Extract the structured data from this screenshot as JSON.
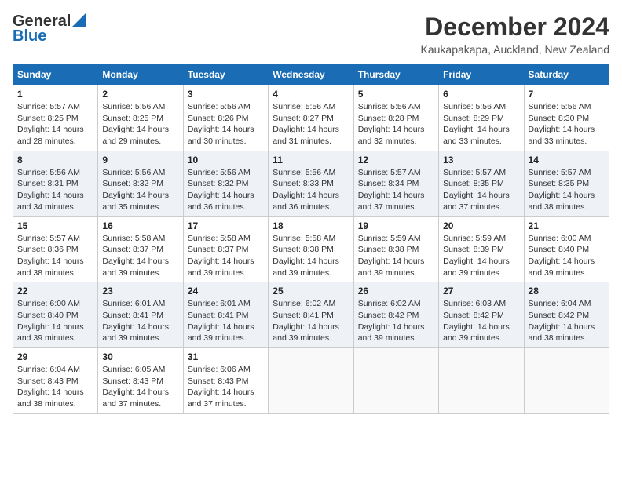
{
  "header": {
    "logo_general": "General",
    "logo_blue": "Blue",
    "month_title": "December 2024",
    "location": "Kaukapakapa, Auckland, New Zealand"
  },
  "calendar": {
    "days_of_week": [
      "Sunday",
      "Monday",
      "Tuesday",
      "Wednesday",
      "Thursday",
      "Friday",
      "Saturday"
    ],
    "weeks": [
      [
        {
          "day": "1",
          "sunrise": "5:57 AM",
          "sunset": "8:25 PM",
          "daylight": "14 hours and 28 minutes."
        },
        {
          "day": "2",
          "sunrise": "5:56 AM",
          "sunset": "8:25 PM",
          "daylight": "14 hours and 29 minutes."
        },
        {
          "day": "3",
          "sunrise": "5:56 AM",
          "sunset": "8:26 PM",
          "daylight": "14 hours and 30 minutes."
        },
        {
          "day": "4",
          "sunrise": "5:56 AM",
          "sunset": "8:27 PM",
          "daylight": "14 hours and 31 minutes."
        },
        {
          "day": "5",
          "sunrise": "5:56 AM",
          "sunset": "8:28 PM",
          "daylight": "14 hours and 32 minutes."
        },
        {
          "day": "6",
          "sunrise": "5:56 AM",
          "sunset": "8:29 PM",
          "daylight": "14 hours and 33 minutes."
        },
        {
          "day": "7",
          "sunrise": "5:56 AM",
          "sunset": "8:30 PM",
          "daylight": "14 hours and 33 minutes."
        }
      ],
      [
        {
          "day": "8",
          "sunrise": "5:56 AM",
          "sunset": "8:31 PM",
          "daylight": "14 hours and 34 minutes."
        },
        {
          "day": "9",
          "sunrise": "5:56 AM",
          "sunset": "8:32 PM",
          "daylight": "14 hours and 35 minutes."
        },
        {
          "day": "10",
          "sunrise": "5:56 AM",
          "sunset": "8:32 PM",
          "daylight": "14 hours and 36 minutes."
        },
        {
          "day": "11",
          "sunrise": "5:56 AM",
          "sunset": "8:33 PM",
          "daylight": "14 hours and 36 minutes."
        },
        {
          "day": "12",
          "sunrise": "5:57 AM",
          "sunset": "8:34 PM",
          "daylight": "14 hours and 37 minutes."
        },
        {
          "day": "13",
          "sunrise": "5:57 AM",
          "sunset": "8:35 PM",
          "daylight": "14 hours and 37 minutes."
        },
        {
          "day": "14",
          "sunrise": "5:57 AM",
          "sunset": "8:35 PM",
          "daylight": "14 hours and 38 minutes."
        }
      ],
      [
        {
          "day": "15",
          "sunrise": "5:57 AM",
          "sunset": "8:36 PM",
          "daylight": "14 hours and 38 minutes."
        },
        {
          "day": "16",
          "sunrise": "5:58 AM",
          "sunset": "8:37 PM",
          "daylight": "14 hours and 39 minutes."
        },
        {
          "day": "17",
          "sunrise": "5:58 AM",
          "sunset": "8:37 PM",
          "daylight": "14 hours and 39 minutes."
        },
        {
          "day": "18",
          "sunrise": "5:58 AM",
          "sunset": "8:38 PM",
          "daylight": "14 hours and 39 minutes."
        },
        {
          "day": "19",
          "sunrise": "5:59 AM",
          "sunset": "8:38 PM",
          "daylight": "14 hours and 39 minutes."
        },
        {
          "day": "20",
          "sunrise": "5:59 AM",
          "sunset": "8:39 PM",
          "daylight": "14 hours and 39 minutes."
        },
        {
          "day": "21",
          "sunrise": "6:00 AM",
          "sunset": "8:40 PM",
          "daylight": "14 hours and 39 minutes."
        }
      ],
      [
        {
          "day": "22",
          "sunrise": "6:00 AM",
          "sunset": "8:40 PM",
          "daylight": "14 hours and 39 minutes."
        },
        {
          "day": "23",
          "sunrise": "6:01 AM",
          "sunset": "8:41 PM",
          "daylight": "14 hours and 39 minutes."
        },
        {
          "day": "24",
          "sunrise": "6:01 AM",
          "sunset": "8:41 PM",
          "daylight": "14 hours and 39 minutes."
        },
        {
          "day": "25",
          "sunrise": "6:02 AM",
          "sunset": "8:41 PM",
          "daylight": "14 hours and 39 minutes."
        },
        {
          "day": "26",
          "sunrise": "6:02 AM",
          "sunset": "8:42 PM",
          "daylight": "14 hours and 39 minutes."
        },
        {
          "day": "27",
          "sunrise": "6:03 AM",
          "sunset": "8:42 PM",
          "daylight": "14 hours and 39 minutes."
        },
        {
          "day": "28",
          "sunrise": "6:04 AM",
          "sunset": "8:42 PM",
          "daylight": "14 hours and 38 minutes."
        }
      ],
      [
        {
          "day": "29",
          "sunrise": "6:04 AM",
          "sunset": "8:43 PM",
          "daylight": "14 hours and 38 minutes."
        },
        {
          "day": "30",
          "sunrise": "6:05 AM",
          "sunset": "8:43 PM",
          "daylight": "14 hours and 37 minutes."
        },
        {
          "day": "31",
          "sunrise": "6:06 AM",
          "sunset": "8:43 PM",
          "daylight": "14 hours and 37 minutes."
        },
        null,
        null,
        null,
        null
      ]
    ]
  }
}
